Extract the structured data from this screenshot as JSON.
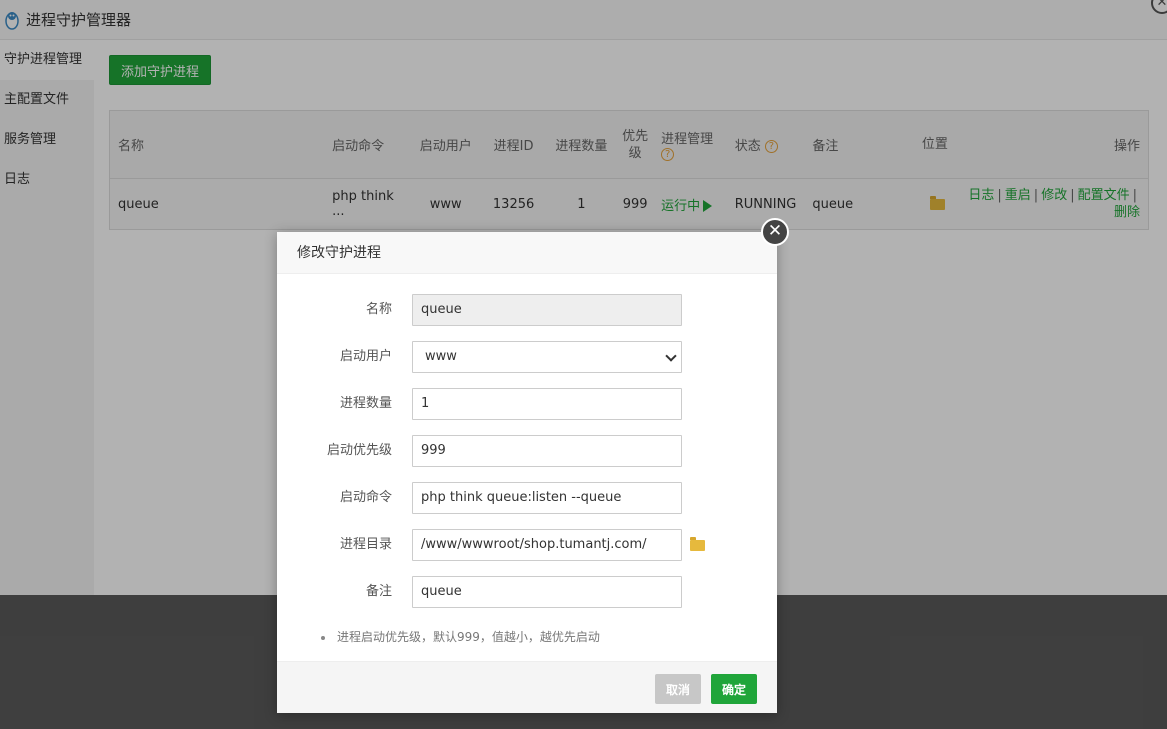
{
  "window": {
    "title": "进程守护管理器"
  },
  "sidebar": {
    "items": [
      {
        "label": "守护进程管理"
      },
      {
        "label": "主配置文件"
      },
      {
        "label": "服务管理"
      },
      {
        "label": "日志"
      }
    ]
  },
  "toolbar": {
    "add_label": "添加守护进程"
  },
  "table": {
    "headers": {
      "name": "名称",
      "cmd": "启动命令",
      "user": "启动用户",
      "pid": "进程ID",
      "count": "进程数量",
      "priority": "优先级",
      "manage": "进程管理",
      "status": "状态",
      "note": "备注",
      "location": "位置",
      "ops": "操作"
    },
    "rows": [
      {
        "name": "queue",
        "cmd": "php think ...",
        "user": "www",
        "pid": "13256",
        "count": "1",
        "priority": "999",
        "manage": "运行中",
        "status": "RUNNING",
        "note": "queue",
        "ops": [
          "日志",
          "重启",
          "修改",
          "配置文件",
          "删除"
        ]
      }
    ]
  },
  "modal": {
    "title": "修改守护进程",
    "fields": {
      "name": {
        "label": "名称",
        "value": "queue"
      },
      "user": {
        "label": "启动用户",
        "value": "www"
      },
      "count": {
        "label": "进程数量",
        "value": "1"
      },
      "priority": {
        "label": "启动优先级",
        "value": "999"
      },
      "cmd": {
        "label": "启动命令",
        "value": "php think queue:listen --queue"
      },
      "dir": {
        "label": "进程目录",
        "value": "/www/wwwroot/shop.tumantj.com/"
      },
      "note": {
        "label": "备注",
        "value": "queue"
      }
    },
    "tip": "进程启动优先级，默认999，值越小，越优先启动",
    "cancel_label": "取消",
    "ok_label": "确定"
  },
  "colors": {
    "accent": "#20a53a",
    "warning": "#e6a23c",
    "folder": "#e6b93d"
  }
}
